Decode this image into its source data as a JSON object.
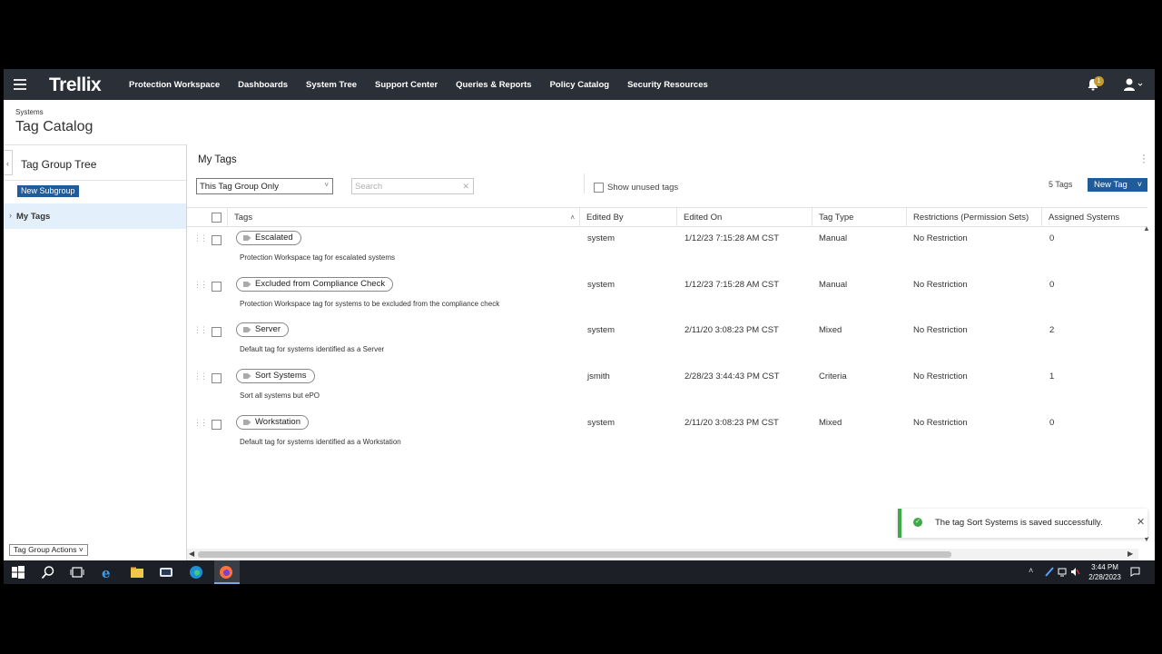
{
  "nav": {
    "logo": "Trellix",
    "menu": [
      "Protection Workspace",
      "Dashboards",
      "System Tree",
      "Support Center",
      "Queries & Reports",
      "Policy Catalog",
      "Security Resources"
    ],
    "notification_count": "1"
  },
  "header": {
    "breadcrumb": "Systems",
    "title": "Tag Catalog"
  },
  "left_panel": {
    "title": "Tag Group Tree",
    "new_subgroup_label": "New Subgroup",
    "tree_items": [
      "My Tags"
    ],
    "actions_label": "Tag Group Actions"
  },
  "right_panel": {
    "title": "My Tags",
    "filter_value": "This Tag Group Only",
    "search_placeholder": "Search",
    "show_unused_label": "Show unused tags",
    "show_unused_checked": false,
    "tag_count": "5 Tags",
    "new_tag_label": "New Tag"
  },
  "table": {
    "columns": [
      "Tags",
      "Edited By",
      "Edited On",
      "Tag Type",
      "Restrictions (Permission Sets)",
      "Assigned Systems"
    ],
    "rows": [
      {
        "tag": "Escalated",
        "desc": "Protection Workspace tag for escalated systems",
        "edited_by": "system",
        "edited_on": "1/12/23 7:15:28 AM CST",
        "type": "Manual",
        "restrictions": "No Restriction",
        "assigned": "0"
      },
      {
        "tag": "Excluded from Compliance Check",
        "desc": "Protection Workspace tag for systems to be excluded from the compliance check",
        "edited_by": "system",
        "edited_on": "1/12/23 7:15:28 AM CST",
        "type": "Manual",
        "restrictions": "No Restriction",
        "assigned": "0"
      },
      {
        "tag": "Server",
        "desc": "Default tag for systems identified as a Server",
        "edited_by": "system",
        "edited_on": "2/11/20 3:08:23 PM CST",
        "type": "Mixed",
        "restrictions": "No Restriction",
        "assigned": "2"
      },
      {
        "tag": "Sort Systems",
        "desc": "Sort all systems but ePO",
        "edited_by": "jsmith",
        "edited_on": "2/28/23 3:44:43 PM CST",
        "type": "Criteria",
        "restrictions": "No Restriction",
        "assigned": "1"
      },
      {
        "tag": "Workstation",
        "desc": "Default tag for systems identified as a Workstation",
        "edited_by": "system",
        "edited_on": "2/11/20 3:08:23 PM CST",
        "type": "Mixed",
        "restrictions": "No Restriction",
        "assigned": "0"
      }
    ]
  },
  "toast": {
    "message": "The tag Sort Systems is saved successfully."
  },
  "taskbar": {
    "apps": [
      "start-icon",
      "search-icon",
      "task-view-icon",
      "internet-explorer-icon",
      "file-explorer-icon",
      "powershell-icon",
      "edge-icon",
      "firefox-icon"
    ],
    "time": "3:44 PM",
    "date": "2/28/2023"
  },
  "colors": {
    "nav_bg": "#2b2f38",
    "accent": "#1f5c99",
    "success": "#3da947",
    "selected_row": "#e3f0fb"
  }
}
